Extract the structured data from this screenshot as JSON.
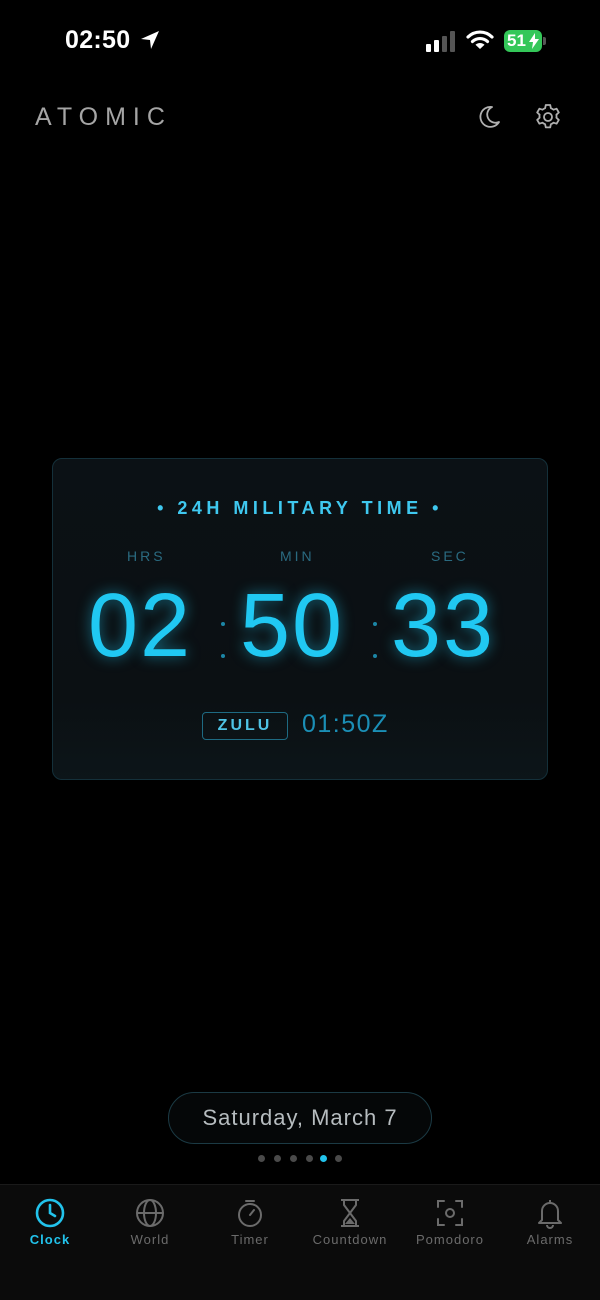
{
  "status_bar": {
    "time": "02:50",
    "battery": "51"
  },
  "header": {
    "title": "ATOMIC"
  },
  "clock": {
    "heading": "• 24H MILITARY TIME •",
    "labels": {
      "hours": "HRS",
      "minutes": "MIN",
      "seconds": "SEC"
    },
    "hours": "02",
    "minutes": "50",
    "seconds": "33",
    "zulu_badge": "ZULU",
    "zulu_time": "01:50Z"
  },
  "date": "Saturday, March 7",
  "page_dots": {
    "count": 6,
    "active_index": 4
  },
  "tabs": [
    {
      "label": "Clock",
      "icon": "clock-icon",
      "active": true
    },
    {
      "label": "World",
      "icon": "globe-icon",
      "active": false
    },
    {
      "label": "Timer",
      "icon": "stopwatch-icon",
      "active": false
    },
    {
      "label": "Countdown",
      "icon": "hourglass-icon",
      "active": false
    },
    {
      "label": "Pomodoro",
      "icon": "focus-icon",
      "active": false
    },
    {
      "label": "Alarms",
      "icon": "bell-icon",
      "active": false
    }
  ],
  "colors": {
    "accent": "#22c3ec",
    "background": "#000000",
    "battery": "#34c759"
  }
}
